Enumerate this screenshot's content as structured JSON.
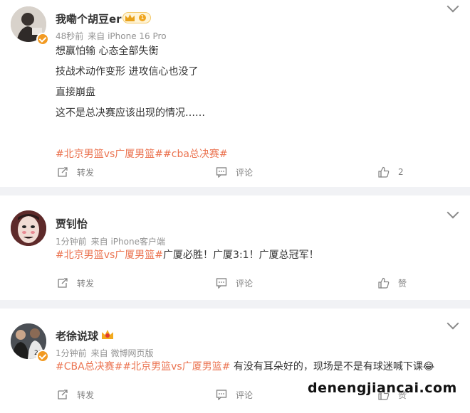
{
  "posts": [
    {
      "username": "我嘞个胡豆er",
      "level": "1",
      "time": "48秒前",
      "source": "来自 iPhone 16 Pro",
      "lines": [
        "想赢怕输 心态全部失衡",
        "技战术动作变形 进攻信心也没了",
        "直接崩盘",
        "这不是总决赛应该出现的情况……"
      ],
      "hashtags": "#北京男篮vs广厦男篮##cba总决赛#",
      "repost_label": "转发",
      "comment_label": "评论",
      "like_label": "2"
    },
    {
      "username": "贾钊怡",
      "time": "1分钟前",
      "source": "来自 iPhone客户端",
      "hashtags": "#北京男篮vs广厦男篮#",
      "text": "广厦必胜！广厦3:1！广厦总冠军！",
      "repost_label": "转发",
      "comment_label": "评论",
      "like_label": "赞"
    },
    {
      "username": "老徐说球",
      "time": "1分钟前",
      "source": "来自 微博网页版",
      "hashtags": "#CBA总决赛##北京男篮vs广厦男篮#",
      "text": " 有没有耳朵好的，现场是不是有球迷喊下课😂",
      "repost_label": "转发",
      "comment_label": "评论",
      "like_label": "赞"
    }
  ],
  "watermark": "denengjiancai.com",
  "colors": {
    "hashtag": "#eb7350",
    "meta": "#939393",
    "background": "#f1f2f5",
    "verified": "#f29a22"
  },
  "icons": {
    "repost": "repost-icon",
    "comment": "comment-icon",
    "like": "thumbs-up-icon",
    "menu": "chevron-down-icon"
  }
}
